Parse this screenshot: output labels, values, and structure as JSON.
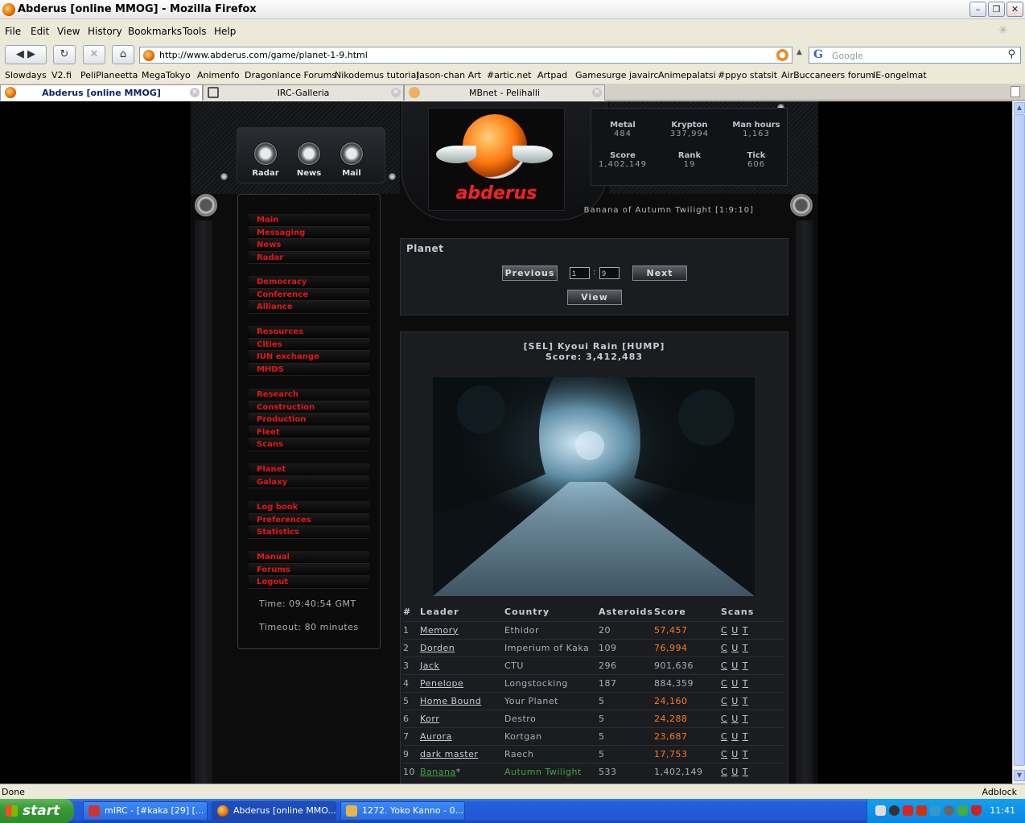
{
  "window": {
    "title": "Abderus [online MMOG] - Mozilla Firefox"
  },
  "menubar": [
    "File",
    "Edit",
    "View",
    "History",
    "Bookmarks",
    "Tools",
    "Help"
  ],
  "address": {
    "url": "http://www.abderus.com/game/planet-1-9.html"
  },
  "search": {
    "placeholder": "Google"
  },
  "bookmarks": [
    "Slowdays",
    "V2.fi",
    "PeliPlaneetta",
    "MegaTokyo",
    "Animenfo",
    "Dragonlance Forums",
    "Nikodemus tutorial",
    "Jason-chan Art",
    "#artic.net",
    "Artpad",
    "Gamesurge javairc",
    "Animepalatsi",
    "#ppyo statsit",
    "AirBuccaneers forum",
    "IE-ongelmat"
  ],
  "tabs": [
    {
      "label": "Abderus [online MMOG]",
      "active": true
    },
    {
      "label": "IRC-Galleria",
      "active": false
    },
    {
      "label": "MBnet - Pelihalli",
      "active": false
    }
  ],
  "game": {
    "logo": "abderus",
    "top_buttons": [
      "Radar",
      "News",
      "Mail"
    ],
    "resources": [
      {
        "label": "Metal",
        "value": "484"
      },
      {
        "label": "Krypton",
        "value": "337,994"
      },
      {
        "label": "Man hours",
        "value": "1,163"
      },
      {
        "label": "Score",
        "value": "1,402,149"
      },
      {
        "label": "Rank",
        "value": "19"
      },
      {
        "label": "Tick",
        "value": "606"
      }
    ],
    "planet_name": "Banana of Autumn Twilight [1:9:10]",
    "menu_groups": [
      [
        "Main",
        "Messaging",
        "News",
        "Radar"
      ],
      [
        "Democracy",
        "Conference",
        "Alliance"
      ],
      [
        "Resources",
        "Cities",
        "IUN exchange",
        "MHDS"
      ],
      [
        "Research",
        "Construction",
        "Production",
        "Fleet",
        "Scans"
      ],
      [
        "Planet",
        "Galaxy"
      ],
      [
        "Log book",
        "Preferences",
        "Statistics"
      ],
      [
        "Manual",
        "Forums",
        "Logout"
      ]
    ],
    "time": "Time: 09:40:54 GMT",
    "timeout": "Timeout: 80 minutes",
    "planet_panel": {
      "title": "Planet",
      "prev_label": "Previous",
      "next_label": "Next",
      "view_label": "View",
      "x": "1",
      "y": "9"
    },
    "galaxy": {
      "name": "[SEL] Kyoui Rain [HUMP]",
      "score": "Score: 3,412,483"
    },
    "table": {
      "headers": [
        "#",
        "Leader",
        "Country",
        "Asteroids",
        "Score",
        "Scans"
      ],
      "rows": [
        {
          "n": "1",
          "leader": "Memory",
          "country": "Ethidor",
          "asteroids": "20",
          "score": "57,457",
          "hi": true,
          "me": false
        },
        {
          "n": "2",
          "leader": "Dorden",
          "country": "Imperium of Kaka",
          "asteroids": "109",
          "score": "76,994",
          "hi": true,
          "me": false
        },
        {
          "n": "3",
          "leader": "Jack",
          "country": "CTU",
          "asteroids": "296",
          "score": "901,636",
          "hi": false,
          "me": false
        },
        {
          "n": "4",
          "leader": "Penelope",
          "country": "Longstocking",
          "asteroids": "187",
          "score": "884,359",
          "hi": false,
          "me": false
        },
        {
          "n": "5",
          "leader": "Home Bound",
          "country": "Your Planet",
          "asteroids": "5",
          "score": "24,160",
          "hi": true,
          "me": false
        },
        {
          "n": "6",
          "leader": "Korr",
          "country": "Destro",
          "asteroids": "5",
          "score": "24,288",
          "hi": true,
          "me": false
        },
        {
          "n": "7",
          "leader": "Aurora",
          "country": "Kortgan",
          "asteroids": "5",
          "score": "23,687",
          "hi": true,
          "me": false
        },
        {
          "n": "9",
          "leader": "dark master",
          "country": "Raech",
          "asteroids": "5",
          "score": "17,753",
          "hi": true,
          "me": false
        },
        {
          "n": "10",
          "leader": "Banana",
          "country": "Autumn Twilight",
          "asteroids": "533",
          "score": "1,402,149",
          "hi": false,
          "me": true
        }
      ],
      "scan_links": [
        "C",
        "U",
        "T"
      ]
    }
  },
  "statusbar": {
    "left": "Done",
    "right": "Adblock"
  },
  "taskbar": {
    "start": "start",
    "tasks": [
      {
        "label": "mIRC - [#kaka [29] [...",
        "active": false
      },
      {
        "label": "Abderus [online MMO...",
        "active": true
      },
      {
        "label": "1272. Yoko Kanno - 0...",
        "active": false
      }
    ],
    "clock": "11:41"
  },
  "colors": {
    "menu_red": "#e01818",
    "highlight_orange": "#ff7a1a",
    "self_green": "#3fa83f",
    "xp_blue": "#245edb"
  }
}
